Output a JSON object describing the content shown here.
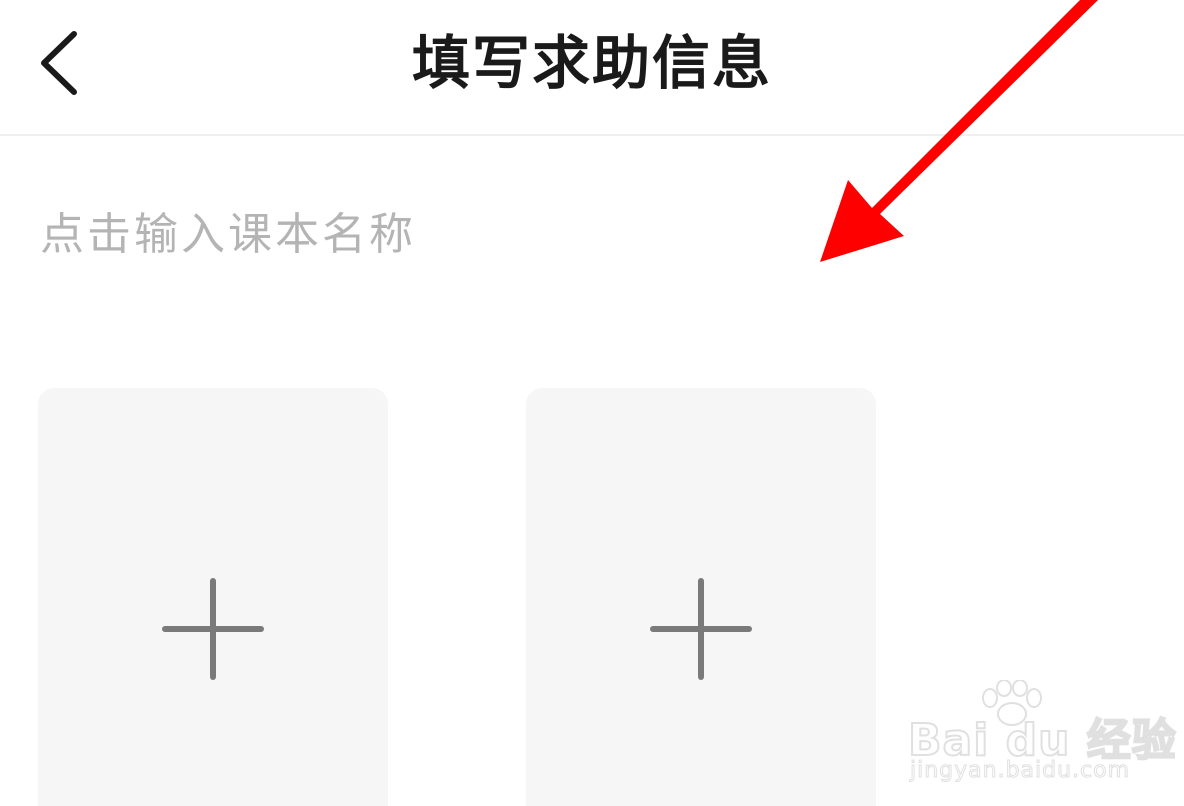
{
  "header": {
    "title": "填写求助信息",
    "back_icon": "chevron-left-icon"
  },
  "form": {
    "textbook_name_placeholder": "点击输入课本名称",
    "textbook_name_value": ""
  },
  "uploads": [
    {
      "icon": "plus-icon"
    },
    {
      "icon": "plus-icon"
    }
  ],
  "annotation": {
    "arrow_color": "#ff0000"
  },
  "watermark": {
    "logo_text": "Bai du 经验",
    "url": "jingyan.baidu.com"
  }
}
